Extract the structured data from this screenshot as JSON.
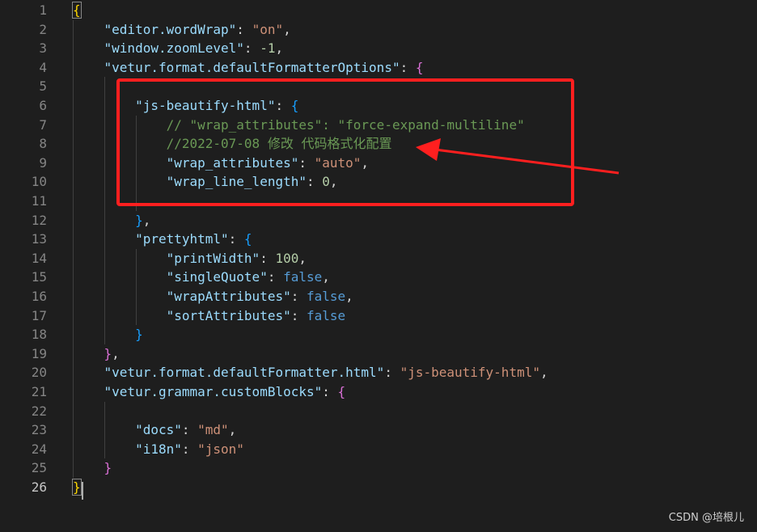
{
  "editor": {
    "lines": [
      {
        "num": "1",
        "tokens": [
          {
            "t": "{",
            "c": "br1 brmatch"
          }
        ]
      },
      {
        "num": "2",
        "tokens": [
          {
            "t": "    "
          },
          {
            "t": "\"editor.wordWrap\"",
            "c": "k"
          },
          {
            "t": ": "
          },
          {
            "t": "\"on\"",
            "c": "s"
          },
          {
            "t": ","
          }
        ]
      },
      {
        "num": "3",
        "tokens": [
          {
            "t": "    "
          },
          {
            "t": "\"window.zoomLevel\"",
            "c": "k"
          },
          {
            "t": ": "
          },
          {
            "t": "-1",
            "c": "n"
          },
          {
            "t": ","
          }
        ]
      },
      {
        "num": "4",
        "tokens": [
          {
            "t": "    "
          },
          {
            "t": "\"vetur.format.defaultFormatterOptions\"",
            "c": "k"
          },
          {
            "t": ": "
          },
          {
            "t": "{",
            "c": "br2"
          }
        ]
      },
      {
        "num": "5",
        "tokens": []
      },
      {
        "num": "6",
        "tokens": [
          {
            "t": "        "
          },
          {
            "t": "\"js-beautify-html\"",
            "c": "k"
          },
          {
            "t": ": "
          },
          {
            "t": "{",
            "c": "br3"
          }
        ]
      },
      {
        "num": "7",
        "tokens": [
          {
            "t": "            "
          },
          {
            "t": "// \"wrap_attributes\": \"force-expand-multiline\"",
            "c": "c"
          }
        ]
      },
      {
        "num": "8",
        "tokens": [
          {
            "t": "            "
          },
          {
            "t": "//2022-07-08 修改 代码格式化配置",
            "c": "c"
          }
        ]
      },
      {
        "num": "9",
        "tokens": [
          {
            "t": "            "
          },
          {
            "t": "\"wrap_attributes\"",
            "c": "k"
          },
          {
            "t": ": "
          },
          {
            "t": "\"auto\"",
            "c": "s"
          },
          {
            "t": ","
          }
        ]
      },
      {
        "num": "10",
        "tokens": [
          {
            "t": "            "
          },
          {
            "t": "\"wrap_line_length\"",
            "c": "k"
          },
          {
            "t": ": "
          },
          {
            "t": "0",
            "c": "n"
          },
          {
            "t": ","
          }
        ]
      },
      {
        "num": "11",
        "tokens": []
      },
      {
        "num": "12",
        "tokens": [
          {
            "t": "        "
          },
          {
            "t": "}",
            "c": "br3"
          },
          {
            "t": ","
          }
        ]
      },
      {
        "num": "13",
        "tokens": [
          {
            "t": "        "
          },
          {
            "t": "\"prettyhtml\"",
            "c": "k"
          },
          {
            "t": ": "
          },
          {
            "t": "{",
            "c": "br3"
          }
        ]
      },
      {
        "num": "14",
        "tokens": [
          {
            "t": "            "
          },
          {
            "t": "\"printWidth\"",
            "c": "k"
          },
          {
            "t": ": "
          },
          {
            "t": "100",
            "c": "n"
          },
          {
            "t": ","
          }
        ]
      },
      {
        "num": "15",
        "tokens": [
          {
            "t": "            "
          },
          {
            "t": "\"singleQuote\"",
            "c": "k"
          },
          {
            "t": ": "
          },
          {
            "t": "false",
            "c": "b"
          },
          {
            "t": ","
          }
        ]
      },
      {
        "num": "16",
        "tokens": [
          {
            "t": "            "
          },
          {
            "t": "\"wrapAttributes\"",
            "c": "k"
          },
          {
            "t": ": "
          },
          {
            "t": "false",
            "c": "b"
          },
          {
            "t": ","
          }
        ]
      },
      {
        "num": "17",
        "tokens": [
          {
            "t": "            "
          },
          {
            "t": "\"sortAttributes\"",
            "c": "k"
          },
          {
            "t": ": "
          },
          {
            "t": "false",
            "c": "b"
          }
        ]
      },
      {
        "num": "18",
        "tokens": [
          {
            "t": "        "
          },
          {
            "t": "}",
            "c": "br3"
          }
        ]
      },
      {
        "num": "19",
        "tokens": [
          {
            "t": "    "
          },
          {
            "t": "}",
            "c": "br2"
          },
          {
            "t": ","
          }
        ]
      },
      {
        "num": "20",
        "tokens": [
          {
            "t": "    "
          },
          {
            "t": "\"vetur.format.defaultFormatter.html\"",
            "c": "k"
          },
          {
            "t": ": "
          },
          {
            "t": "\"js-beautify-html\"",
            "c": "s"
          },
          {
            "t": ","
          }
        ]
      },
      {
        "num": "21",
        "tokens": [
          {
            "t": "    "
          },
          {
            "t": "\"vetur.grammar.customBlocks\"",
            "c": "k"
          },
          {
            "t": ": "
          },
          {
            "t": "{",
            "c": "br2"
          }
        ]
      },
      {
        "num": "22",
        "tokens": []
      },
      {
        "num": "23",
        "tokens": [
          {
            "t": "        "
          },
          {
            "t": "\"docs\"",
            "c": "k"
          },
          {
            "t": ": "
          },
          {
            "t": "\"md\"",
            "c": "s"
          },
          {
            "t": ","
          }
        ]
      },
      {
        "num": "24",
        "tokens": [
          {
            "t": "        "
          },
          {
            "t": "\"i18n\"",
            "c": "k"
          },
          {
            "t": ": "
          },
          {
            "t": "\"json\"",
            "c": "s"
          }
        ]
      },
      {
        "num": "25",
        "tokens": [
          {
            "t": "    "
          },
          {
            "t": "}",
            "c": "br2"
          }
        ]
      },
      {
        "num": "26",
        "tokens": [
          {
            "t": "}",
            "c": "br1 brmatch"
          }
        ],
        "active": true
      }
    ]
  },
  "annotation": {
    "box_color": "#ff1f1f",
    "arrow_color": "#ff1f1f"
  },
  "watermark": "CSDN @培根儿"
}
